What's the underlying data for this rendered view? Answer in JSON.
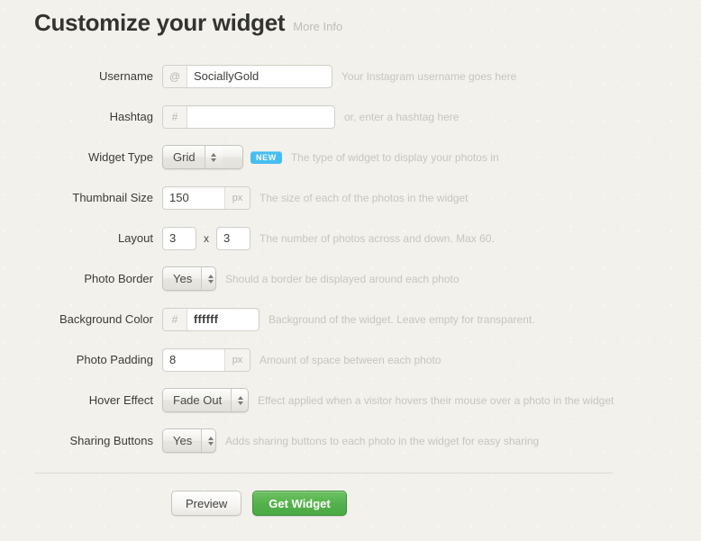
{
  "header": {
    "title": "Customize your widget",
    "more_info_label": "More Info"
  },
  "form": {
    "username": {
      "label": "Username",
      "prefix": "@",
      "value": "SociallyGold",
      "placeholder": "",
      "help": "Your Instagram username goes here"
    },
    "hashtag": {
      "label": "Hashtag",
      "prefix": "#",
      "value": "",
      "placeholder": "",
      "help": "or, enter a hashtag here"
    },
    "widget_type": {
      "label": "Widget Type",
      "value": "Grid",
      "badge": "NEW",
      "help": "The type of widget to display your photos in"
    },
    "thumbnail_size": {
      "label": "Thumbnail Size",
      "value": "150",
      "unit": "px",
      "help": "The size of each of the photos in the widget"
    },
    "layout": {
      "label": "Layout",
      "across": "3",
      "separator": "x",
      "down": "3",
      "help": "The number of photos across and down. Max 60."
    },
    "photo_border": {
      "label": "Photo Border",
      "value": "Yes",
      "help": "Should a border be displayed around each photo"
    },
    "background_color": {
      "label": "Background Color",
      "prefix": "#",
      "value": "ffffff",
      "help": "Background of the widget. Leave empty for transparent."
    },
    "photo_padding": {
      "label": "Photo Padding",
      "value": "8",
      "unit": "px",
      "help": "Amount of space between each photo"
    },
    "hover_effect": {
      "label": "Hover Effect",
      "value": "Fade Out",
      "help": "Effect applied when a visitor hovers their mouse over a photo in the widget"
    },
    "sharing_buttons": {
      "label": "Sharing Buttons",
      "value": "Yes",
      "help": "Adds sharing buttons to each photo in the widget for easy sharing"
    }
  },
  "actions": {
    "preview_label": "Preview",
    "get_widget_label": "Get Widget"
  },
  "colors": {
    "background": "#f2f1ec",
    "accent_green": "#54b24c",
    "badge_blue": "#46bdf0",
    "help_text": "#c7c5bf"
  }
}
